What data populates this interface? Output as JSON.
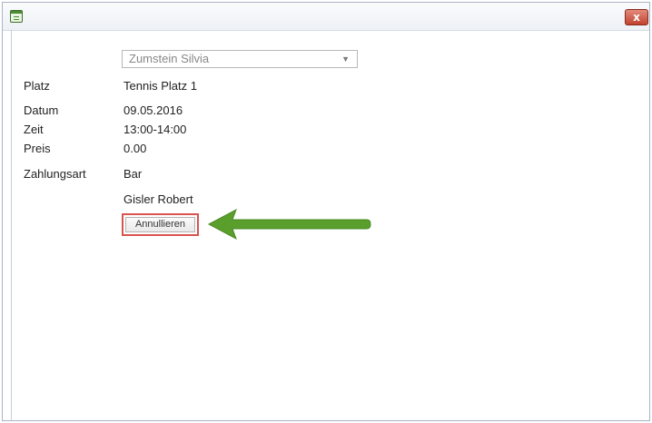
{
  "window": {
    "close_label": "x"
  },
  "form": {
    "member_select": {
      "value": "Zumstein Silvia"
    },
    "fields": [
      {
        "label": "Platz",
        "value": "Tennis Platz 1"
      },
      {
        "label": "Datum",
        "value": "09.05.2016"
      },
      {
        "label": "Zeit",
        "value": "13:00-14:00"
      },
      {
        "label": "Preis",
        "value": "0.00"
      },
      {
        "label": "Zahlungsart",
        "value": "Bar"
      }
    ],
    "booked_by": "Gisler Robert",
    "cancel_label": "Annullieren"
  },
  "colors": {
    "highlight_border": "#d9534f",
    "arrow": "#5a9e2c",
    "close_button": "#c0432f"
  }
}
